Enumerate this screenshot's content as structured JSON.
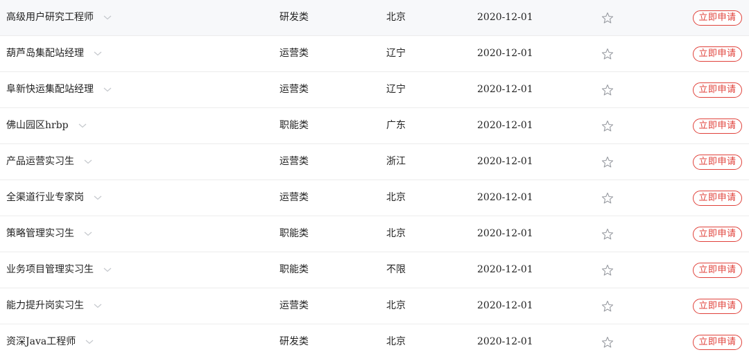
{
  "jobs": [
    {
      "title": "高级用户研究工程师",
      "category": "研发类",
      "location": "北京",
      "date": "2020-12-01",
      "apply_label": "立即申请"
    },
    {
      "title": "葫芦岛集配站经理",
      "category": "运营类",
      "location": "辽宁",
      "date": "2020-12-01",
      "apply_label": "立即申请"
    },
    {
      "title": "阜新快运集配站经理",
      "category": "运营类",
      "location": "辽宁",
      "date": "2020-12-01",
      "apply_label": "立即申请"
    },
    {
      "title": "佛山园区hrbp",
      "category": "职能类",
      "location": "广东",
      "date": "2020-12-01",
      "apply_label": "立即申请"
    },
    {
      "title": "产品运营实习生",
      "category": "运营类",
      "location": "浙江",
      "date": "2020-12-01",
      "apply_label": "立即申请"
    },
    {
      "title": "全渠道行业专家岗",
      "category": "运营类",
      "location": "北京",
      "date": "2020-12-01",
      "apply_label": "立即申请"
    },
    {
      "title": "策略管理实习生",
      "category": "职能类",
      "location": "北京",
      "date": "2020-12-01",
      "apply_label": "立即申请"
    },
    {
      "title": "业务项目管理实习生",
      "category": "职能类",
      "location": "不限",
      "date": "2020-12-01",
      "apply_label": "立即申请"
    },
    {
      "title": "能力提升岗实习生",
      "category": "运营类",
      "location": "北京",
      "date": "2020-12-01",
      "apply_label": "立即申请"
    },
    {
      "title": "资深Java工程师",
      "category": "研发类",
      "location": "北京",
      "date": "2020-12-01",
      "apply_label": "立即申请"
    }
  ],
  "icons": {
    "expand": "chevron-down-icon",
    "favorite": "star-outline-icon"
  },
  "colors": {
    "accent": "#e0413a",
    "highlight_row": "#f7f8fa"
  }
}
